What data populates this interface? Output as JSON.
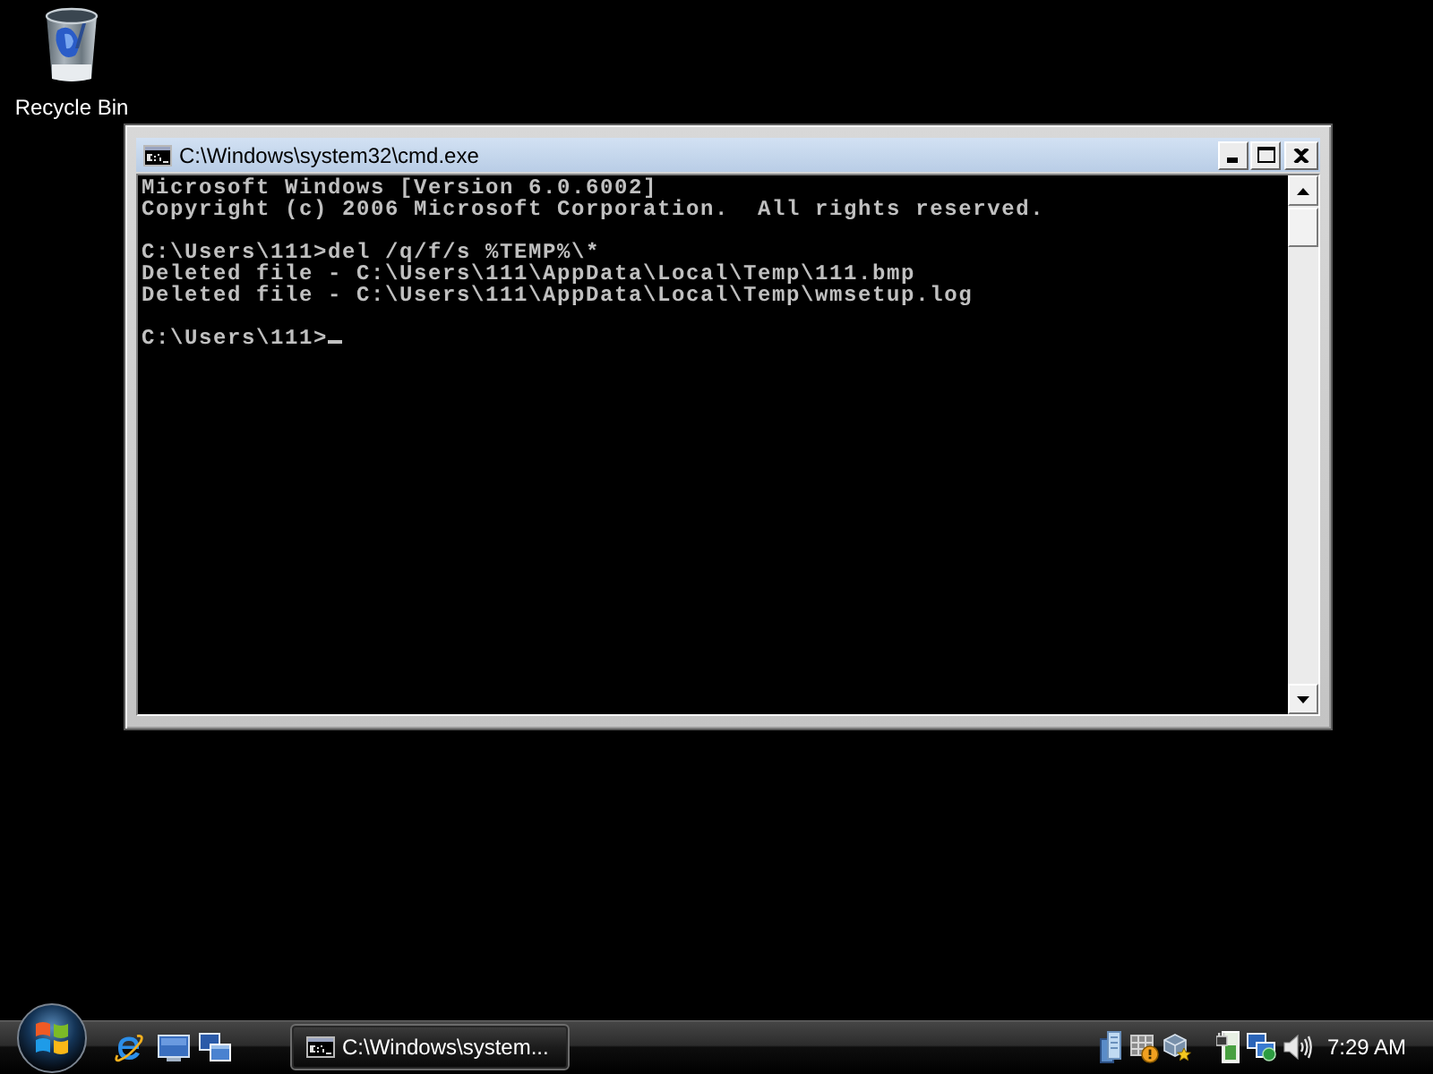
{
  "desktop_icons": [
    {
      "label": "Recycle Bin"
    }
  ],
  "console_window": {
    "title": "C:\\Windows\\system32\\cmd.exe",
    "blocks": [
      {
        "lines": [
          "Microsoft Windows [Version 6.0.6002]",
          "Copyright (c) 2006 Microsoft Corporation.  All rights reserved."
        ]
      },
      {
        "lines": [
          "C:\\Users\\111>del /q/f/s %TEMP%\\*",
          "Deleted file - C:\\Users\\111\\AppData\\Local\\Temp\\111.bmp",
          "Deleted file - C:\\Users\\111\\AppData\\Local\\Temp\\wmsetup.log"
        ]
      },
      {
        "lines": [
          "C:\\Users\\111>"
        ]
      }
    ],
    "cursor": true
  },
  "taskbar": {
    "task_buttons": [
      {
        "label": "C:\\Windows\\system..."
      }
    ],
    "clock": "7:29 AM"
  }
}
